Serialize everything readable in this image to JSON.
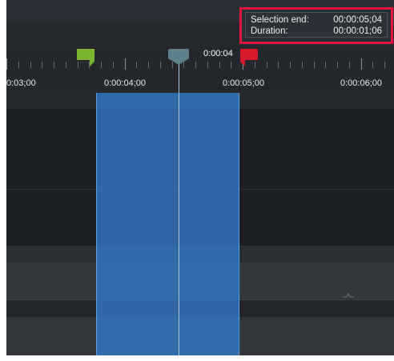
{
  "ruler": {
    "labels": [
      "0:03;00",
      "0:00:04;00",
      "0:00:05;00",
      "0:00:06;00"
    ]
  },
  "playhead": {
    "time": "0:00:04"
  },
  "tooltip": {
    "selection_end_label": "Selection end:",
    "selection_end_value": "00:00:05;04",
    "duration_label": "Duration:",
    "duration_value": "00:00:01;06"
  },
  "colors": {
    "selection": "#347ac9",
    "start_marker": "#7ab32e",
    "end_marker": "#d51b2c",
    "playhead": "#5e7f8c",
    "highlight_box": "#e3173b"
  }
}
